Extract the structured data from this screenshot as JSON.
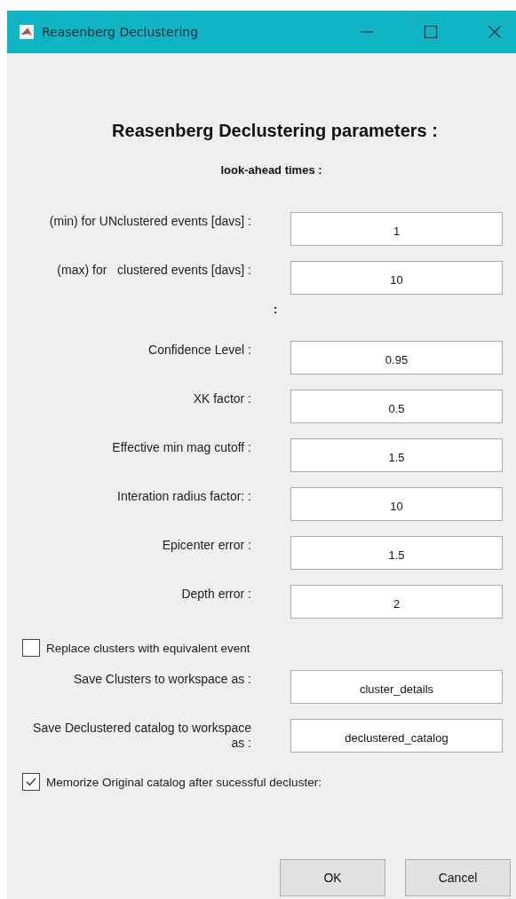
{
  "window": {
    "title": "Reasenberg Declustering"
  },
  "heading": "Reasenberg Declustering parameters :",
  "subheading": "look-ahead times :",
  "rows": [
    {
      "kind": "field",
      "label": "(min) for UNclustered events [davs] :",
      "value": "1"
    },
    {
      "kind": "field",
      "label": "(max) for   clustered events [davs] :",
      "value": "10"
    },
    {
      "kind": "note",
      "text": ":"
    },
    {
      "kind": "field",
      "label": "Confidence Level :",
      "value": "0.95"
    },
    {
      "kind": "field",
      "label": "XK factor :",
      "value": "0.5"
    },
    {
      "kind": "field",
      "label": "Effective min mag cutoff :",
      "value": "1.5"
    },
    {
      "kind": "field",
      "label": "Interation radius factor: :",
      "value": "10"
    },
    {
      "kind": "field",
      "label": "Epicenter error :",
      "value": "1.5"
    },
    {
      "kind": "field",
      "label": "Depth error :",
      "value": "2"
    },
    {
      "kind": "checkbox",
      "label": "Replace clusters with equivalent event",
      "checked": false
    },
    {
      "kind": "field",
      "label": "Save Clusters to workspace as :",
      "value": "cluster_details"
    },
    {
      "kind": "field",
      "label": "Save Declustered catalog to workspace as :",
      "value": "declustered_catalog"
    },
    {
      "kind": "checkbox",
      "label": "Memorize Original catalog after sucessful decluster:",
      "checked": true
    }
  ],
  "buttons": [
    {
      "label": "OK"
    },
    {
      "label": "Cancel"
    }
  ]
}
